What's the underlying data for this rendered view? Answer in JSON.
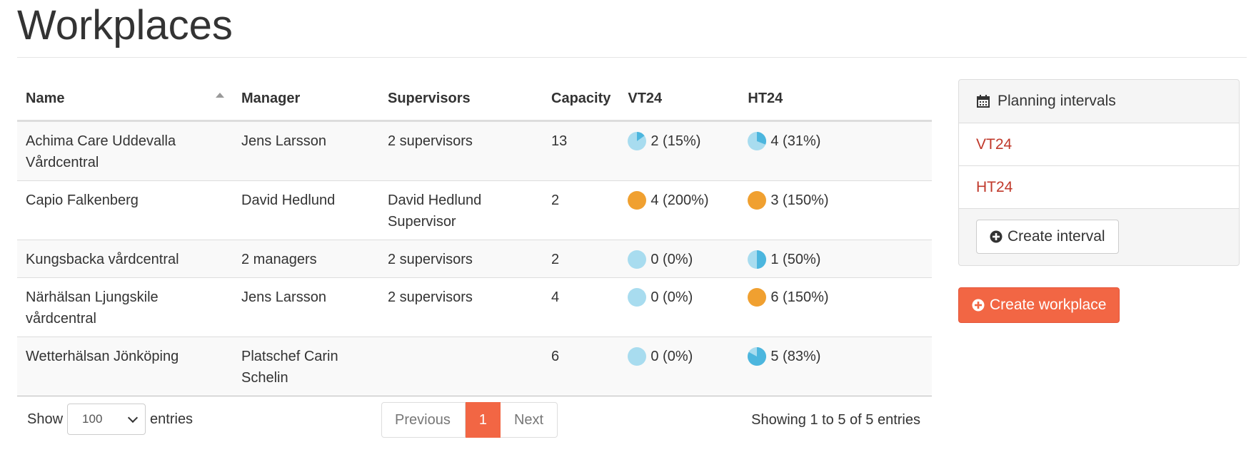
{
  "page": {
    "title": "Workplaces"
  },
  "table": {
    "columns": [
      "Name",
      "Manager",
      "Supervisors",
      "Capacity",
      "VT24",
      "HT24"
    ],
    "sorted_column": "Name",
    "rows": [
      {
        "name": "Achima Care Uddevalla Vårdcentral",
        "manager": "Jens Larsson",
        "supervisors": "2 supervisors",
        "capacity": "13",
        "vt24": {
          "text": "2 (15%)",
          "fraction": 0.15
        },
        "ht24": {
          "text": "4 (31%)",
          "fraction": 0.31
        }
      },
      {
        "name": "Capio Falkenberg",
        "manager": "David Hedlund",
        "supervisors": "David Hedlund Supervisor",
        "capacity": "2",
        "vt24": {
          "text": "4 (200%)",
          "fraction": 2.0
        },
        "ht24": {
          "text": "3 (150%)",
          "fraction": 1.5
        }
      },
      {
        "name": "Kungsbacka vårdcentral",
        "manager": "2 managers",
        "supervisors": "2 supervisors",
        "capacity": "2",
        "vt24": {
          "text": "0 (0%)",
          "fraction": 0
        },
        "ht24": {
          "text": "1 (50%)",
          "fraction": 0.5
        }
      },
      {
        "name": "Närhälsan Ljungskile vårdcentral",
        "manager": "Jens Larsson",
        "supervisors": "2 supervisors",
        "capacity": "4",
        "vt24": {
          "text": "0 (0%)",
          "fraction": 0
        },
        "ht24": {
          "text": "6 (150%)",
          "fraction": 1.5
        }
      },
      {
        "name": "Wetterhälsan Jönköping",
        "manager": "Platschef Carin Schelin",
        "supervisors": "",
        "capacity": "6",
        "vt24": {
          "text": "0 (0%)",
          "fraction": 0
        },
        "ht24": {
          "text": "5 (83%)",
          "fraction": 0.83
        }
      }
    ]
  },
  "length_menu": {
    "prefix": "Show",
    "selected": "100",
    "suffix": "entries"
  },
  "pagination": {
    "previous": "Previous",
    "current": "1",
    "next": "Next"
  },
  "info": "Showing 1 to 5 of 5 entries",
  "planning": {
    "title": "Planning intervals",
    "intervals": [
      "VT24",
      "HT24"
    ],
    "create_label": "Create interval"
  },
  "create_workplace_label": "Create workplace",
  "colors": {
    "accent": "#f26644",
    "link": "#c0392b",
    "pie_bg": "#a8dcef",
    "pie_fill": "#4cb6de",
    "pie_over": "#f0a030"
  }
}
